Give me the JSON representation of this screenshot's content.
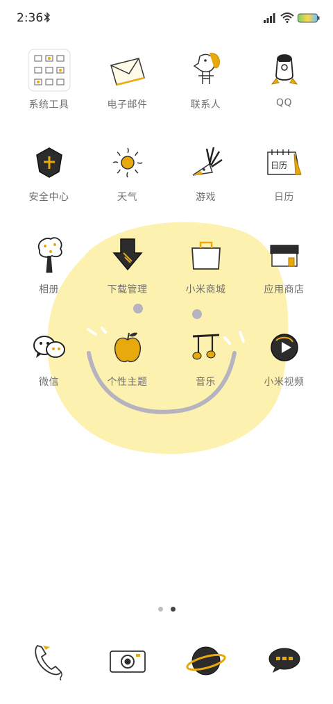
{
  "status_bar": {
    "time": "2:36",
    "icons": [
      "bluetooth-icon",
      "signal-icon",
      "wifi-icon",
      "battery-icon"
    ]
  },
  "colors": {
    "accent": "#e8a90c",
    "wallpaper_face": "#fdf1b0",
    "label": "#6e6e6e",
    "sketch": "#222222"
  },
  "apps": [
    {
      "label": "系统工具",
      "icon": "folder-icon"
    },
    {
      "label": "电子邮件",
      "icon": "envelope-icon"
    },
    {
      "label": "联系人",
      "icon": "person-icon"
    },
    {
      "label": "QQ",
      "icon": "penguin-icon"
    },
    {
      "label": "安全中心",
      "icon": "shield-icon"
    },
    {
      "label": "天气",
      "icon": "sun-icon"
    },
    {
      "label": "游戏",
      "icon": "bird-icon"
    },
    {
      "label": "日历",
      "icon": "calendar-icon"
    },
    {
      "label": "相册",
      "icon": "tree-icon"
    },
    {
      "label": "下载管理",
      "icon": "download-arrow-icon"
    },
    {
      "label": "小米商城",
      "icon": "shopping-bag-icon"
    },
    {
      "label": "应用商店",
      "icon": "store-house-icon"
    },
    {
      "label": "微信",
      "icon": "chat-bubbles-icon"
    },
    {
      "label": "个性主题",
      "icon": "apple-icon"
    },
    {
      "label": "音乐",
      "icon": "music-note-icon"
    },
    {
      "label": "小米视频",
      "icon": "video-play-icon"
    }
  ],
  "calendar_icon_text": "日历",
  "page_indicator": {
    "pages": 2,
    "current": 2
  },
  "dock": [
    {
      "icon": "phone-icon"
    },
    {
      "icon": "camera-icon"
    },
    {
      "icon": "planet-browser-icon"
    },
    {
      "icon": "message-bubble-icon"
    }
  ]
}
